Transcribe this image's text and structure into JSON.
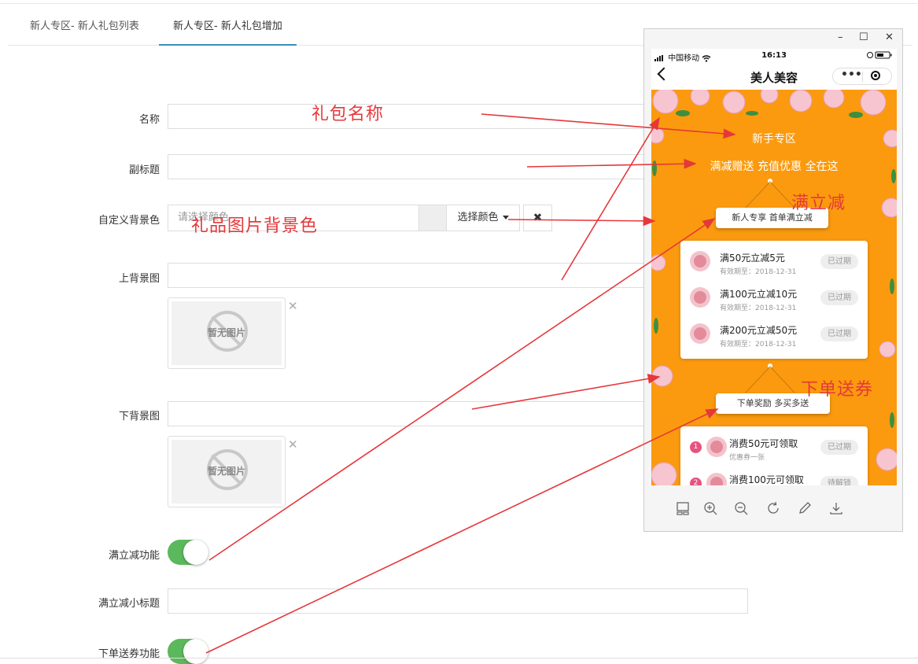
{
  "tabs": [
    {
      "label": "新人专区- 新人礼包列表",
      "active": false
    },
    {
      "label": "新人专区- 新人礼包增加",
      "active": true
    }
  ],
  "form": {
    "name_label": "名称",
    "subtitle_label": "副标题",
    "bgcolor_label": "自定义背景色",
    "bgcolor_placeholder": "请选择颜色",
    "pick_color_label": "选择颜色",
    "clear_label": "✖",
    "top_bg_label": "上背景图",
    "bottom_bg_label": "下背景图",
    "no_image_text": "暂无图片",
    "remove_label": "✕",
    "full_reduce_label": "满立减功能",
    "full_reduce_subtitle_label": "满立减小标题",
    "order_coupon_label": "下单送券功能",
    "full_reduce_on": true,
    "order_coupon_on": true
  },
  "annotations": {
    "gift_name": "礼包名称",
    "gift_bgcolor": "礼品图片背景色",
    "full_reduce": "满立减",
    "order_coupon": "下单送券"
  },
  "phone": {
    "window_controls": {
      "min": "–",
      "max": "☐",
      "close": "✕"
    },
    "carrier": "中国移动",
    "time": "16:13",
    "nav_title": "美人美容",
    "heading": "新手专区",
    "subheading": "满减赠送 充值优惠 全在这",
    "sign1": "新人专享 首单满立减",
    "sign2": "下单奖励 多买多送",
    "coupons": [
      {
        "title": "满50元立减5元",
        "sub": "有效期至：2018-12-31",
        "status": "已过期"
      },
      {
        "title": "满100元立减10元",
        "sub": "有效期至：2018-12-31",
        "status": "已过期"
      },
      {
        "title": "满200元立减50元",
        "sub": "有效期至：2018-12-31",
        "status": "已过期"
      }
    ],
    "order_coupons": [
      {
        "num": "1",
        "title": "消费50元可领取",
        "sub": "优惠券一张",
        "status": "已过期"
      },
      {
        "num": "2",
        "title": "消费100元可领取",
        "sub": "",
        "status": "待解锁"
      }
    ]
  },
  "colors": {
    "accent": "#3c8dbc",
    "toggle_on": "#5cb85c",
    "annotation": "#e5383b",
    "phone_bg": "#fb9a0e",
    "coupon_pink": "#e5547d"
  }
}
